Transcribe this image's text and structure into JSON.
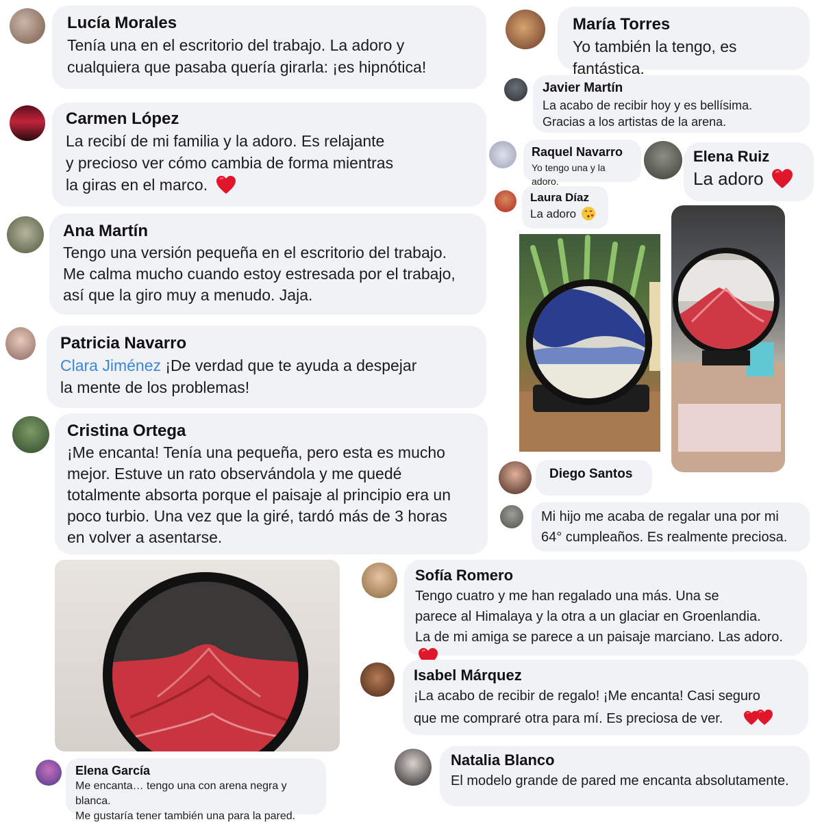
{
  "comments": [
    {
      "name": "Lucía Morales",
      "lines": [
        "Tenía una en el escritorio del trabajo. La adoro y",
        "cualquiera que pasaba quería girarla: ¡es hipnótica!"
      ]
    },
    {
      "name": "Carmen López",
      "lines": [
        "La recibí de mi familia y la adoro. Es relajante",
        "y precioso ver cómo cambia de forma mientras",
        "la giras en el marco."
      ]
    },
    {
      "name": "Ana Martín",
      "lines": [
        "Tengo una versión pequeña en el escritorio del trabajo.",
        "Me calma mucho cuando estoy estresada por el trabajo,",
        "así que la giro muy a menudo. Jaja."
      ]
    },
    {
      "name": "Patricia Navarro",
      "mention": "Clara Jiménez",
      "lines": [
        "¡De verdad que te ayuda a despejar",
        "la mente de los problemas!"
      ]
    },
    {
      "name": "Cristina Ortega",
      "lines": [
        "¡Me encanta! Tenía una pequeña, pero esta es mucho",
        "mejor. Estuve un rato observándola y me quedé",
        "totalmente absorta porque el paisaje al principio era un",
        "poco turbio. Una vez que la giré, tardó más de 3 horas",
        "en volver a asentarse."
      ]
    },
    {
      "name": "Elena García",
      "lines": [
        "Me encanta… tengo una con arena negra y blanca.",
        "Me gustaría tener también una para la pared."
      ]
    },
    {
      "name": "María Torres",
      "lines": [
        "Yo también la tengo, es fantástica."
      ]
    },
    {
      "name": "Javier Martín",
      "lines": [
        "La acabo de recibir hoy y es bellísima.",
        "Gracias a los artistas de la arena."
      ]
    },
    {
      "name": "Raquel Navarro",
      "lines": [
        "Yo tengo una y la adoro."
      ]
    },
    {
      "name": "Elena Ruiz",
      "lines": [
        "La adoro"
      ]
    },
    {
      "name": "Laura Díaz",
      "lines": [
        "La adoro"
      ]
    },
    {
      "name": "Diego Santos",
      "lines": []
    },
    {
      "name": "",
      "lines": [
        "Mi hijo me acaba de regalar una por mi",
        "64° cumpleaños. Es realmente preciosa."
      ]
    },
    {
      "name": "Sofía Romero",
      "lines": [
        "Tengo cuatro y me han regalado una más. Una se",
        "parece al Himalaya y la otra a un glaciar en Groenlandia.",
        "La de mi amiga se parece a un paisaje marciano. Las adoro."
      ]
    },
    {
      "name": "Isabel Márquez",
      "lines": [
        "¡La acabo de recibir de regalo! ¡Me encanta! Casi seguro",
        "que me compraré otra para mí. Es preciosa de ver."
      ]
    },
    {
      "name": "Natalia Blanco",
      "lines": [
        "El modelo grande de pared me encanta absolutamente."
      ]
    }
  ],
  "icons": {
    "heart": "red-heart-icon",
    "kiss": "kissing-face-icon"
  },
  "colors": {
    "bubble": "#f0f2f5",
    "mention": "#3b86d6",
    "heart": "#e0162b"
  }
}
